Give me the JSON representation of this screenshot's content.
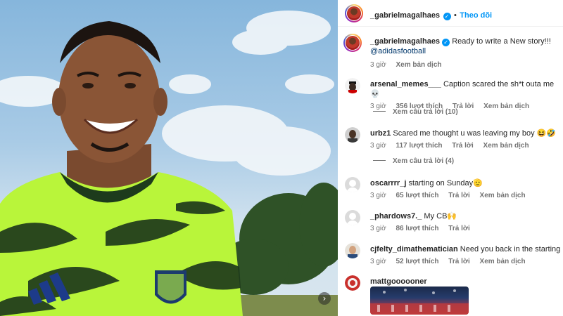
{
  "post": {
    "next_icon": "chevron-right-icon"
  },
  "header": {
    "username": "_gabrielmagalhaes",
    "verified_icon": "verified-check-icon",
    "separator": "•",
    "follow_label": "Theo dõi"
  },
  "caption": {
    "username": "_gabrielmagalhaes",
    "text": "Ready to write a New story!!!",
    "mention": "@adidasfootball",
    "time": "3 giờ",
    "translate": "Xem bản dịch"
  },
  "comments": [
    {
      "username": "arsenal_memes___",
      "text": "Caption scared the sh*t outa me 💀",
      "time": "3 giờ",
      "likes": "356 lượt thích",
      "reply": "Trả lời",
      "translate": "Xem bản dịch",
      "view_replies": "Xem câu trả lời (10)"
    },
    {
      "username": "urbz1",
      "text": "Scared me thought u was leaving my boy 😆🤣",
      "time": "3 giờ",
      "likes": "117 lượt thích",
      "reply": "Trả lời",
      "translate": "Xem bản dịch",
      "view_replies": "Xem câu trả lời (4)"
    },
    {
      "username": "oscarrrr_j",
      "text": "starting on Sunday🫡",
      "time": "3 giờ",
      "likes": "65 lượt thích",
      "reply": "Trả lời",
      "translate": "Xem bản dịch"
    },
    {
      "username": "_phardows7._",
      "text": "My CB🙌",
      "time": "3 giờ",
      "likes": "86 lượt thích",
      "reply": "Trả lời"
    },
    {
      "username": "cjfelty_dimathematician",
      "text": "Need you back in the starting 11",
      "time": "3 giờ",
      "likes": "52 lượt thích",
      "reply": "Trả lời",
      "translate": "Xem bản dịch"
    },
    {
      "username": "mattgoooooner"
    }
  ]
}
